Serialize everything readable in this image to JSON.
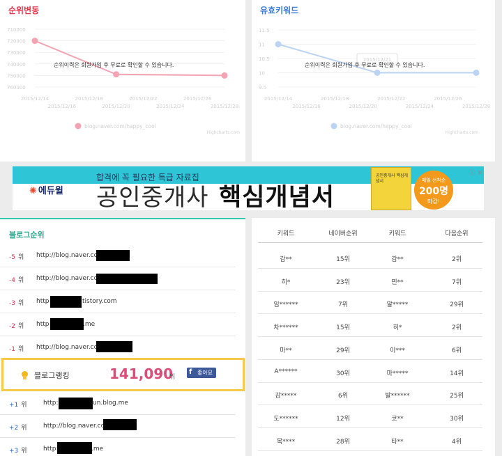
{
  "rank_change_panel": {
    "title": "순위변동",
    "overlay_text": "순위이력은 회원가입 후 무료로 확인할 수 있습니다.",
    "credit": "Highcharts.com",
    "title_color": "#e8334a",
    "chart_data": {
      "type": "line",
      "title": "",
      "x": [
        "2015/12/14",
        "2015/12/20",
        "2015/12/28"
      ],
      "x_ticks": [
        "2015/12/14",
        "2015/12/16",
        "2015/12/18",
        "2015/12/20",
        "2015/12/22",
        "2015/12/24",
        "2015/12/26",
        "2015/12/28"
      ],
      "y_ticks": [
        "710000",
        "720000",
        "730000",
        "740000",
        "750000",
        "760000"
      ],
      "series": [
        {
          "name": "blog.naver.com/happy_cool",
          "values": [
            720000,
            749000,
            750000
          ],
          "color": "#f4a3b3"
        }
      ],
      "ylim": [
        710000,
        760000
      ],
      "y_reversed": true,
      "legend": "bottom",
      "grid": true
    }
  },
  "keyword_panel": {
    "title": "유효키워드",
    "overlay_text": "순위이력은 회원가입 후 무료로 확인할 수 있습니다.",
    "tooltip": "2015/12/21",
    "credit": "Highcharts.com",
    "title_color": "#3a7bd5",
    "chart_data": {
      "type": "line",
      "title": "",
      "x": [
        "2015/12/14",
        "2015/12/21",
        "2015/12/28"
      ],
      "x_ticks": [
        "2015/12/14",
        "2015/12/16",
        "2015/12/18",
        "2015/12/20",
        "2015/12/22",
        "2015/12/24",
        "2015/12/26",
        "2015/12/28"
      ],
      "y_ticks": [
        "11.5",
        "11",
        "10.5",
        "10",
        "9.5"
      ],
      "series": [
        {
          "name": "blog.naver.com/happy_cool",
          "values": [
            11,
            10,
            10
          ],
          "color": "#bcd3f2"
        }
      ],
      "ylim": [
        9.5,
        11.5
      ],
      "legend": "bottom",
      "grid": true
    }
  },
  "banner": {
    "logo": "에듀윌",
    "subtitle": "합격에 꼭 필요한 특급 자료집",
    "headline_1": "공인중개사",
    "headline_2": "핵심개념서",
    "book_text": "공인중개사 핵심개념서",
    "badge_line1": "매일 선착순",
    "badge_line2": "200명",
    "badge_line3": "마감!",
    "ad_icons": "ⓘ ✕"
  },
  "blog_rank": {
    "title": "블로그순위",
    "unit": "위",
    "rows_above": [
      {
        "rank": "-5",
        "url": "http://blog.naver.com/"
      },
      {
        "rank": "-4",
        "url": "http://blog.naver.com/"
      },
      {
        "rank": "-3",
        "url": "http",
        "suffix": "tistory.com"
      },
      {
        "rank": "-2",
        "url": "http",
        "suffix": ".me"
      },
      {
        "rank": "-1",
        "url": "http://blog.naver.com/"
      }
    ],
    "mine": {
      "label": "블로그랭킹",
      "value": "141,090",
      "unit": "위",
      "like": "좋아요"
    },
    "rows_below": [
      {
        "rank": "+1",
        "url": "http:",
        "suffix": "un.blog.me"
      },
      {
        "rank": "+2",
        "url": "http://blog.naver.com/"
      },
      {
        "rank": "+3",
        "url": "http:",
        "suffix": ".me"
      }
    ]
  },
  "keyword_table": {
    "headers": [
      "키워드",
      "네이버순위",
      "키워드",
      "다음순위"
    ],
    "rows": [
      [
        "감**",
        "15위",
        "감**",
        "2위"
      ],
      [
        "히*",
        "23위",
        "민**",
        "7위"
      ],
      [
        "임******",
        "7위",
        "알*****",
        "29위"
      ],
      [
        "차******",
        "15위",
        "히*",
        "2위"
      ],
      [
        "마**",
        "29위",
        "이***",
        "6위"
      ],
      [
        "A******",
        "30위",
        "마*****",
        "14위"
      ],
      [
        "감*****",
        "6위",
        "발******",
        "25위"
      ],
      [
        "도******",
        "12위",
        "코**",
        "30위"
      ],
      [
        "목****",
        "28위",
        "타**",
        "4위"
      ]
    ]
  }
}
